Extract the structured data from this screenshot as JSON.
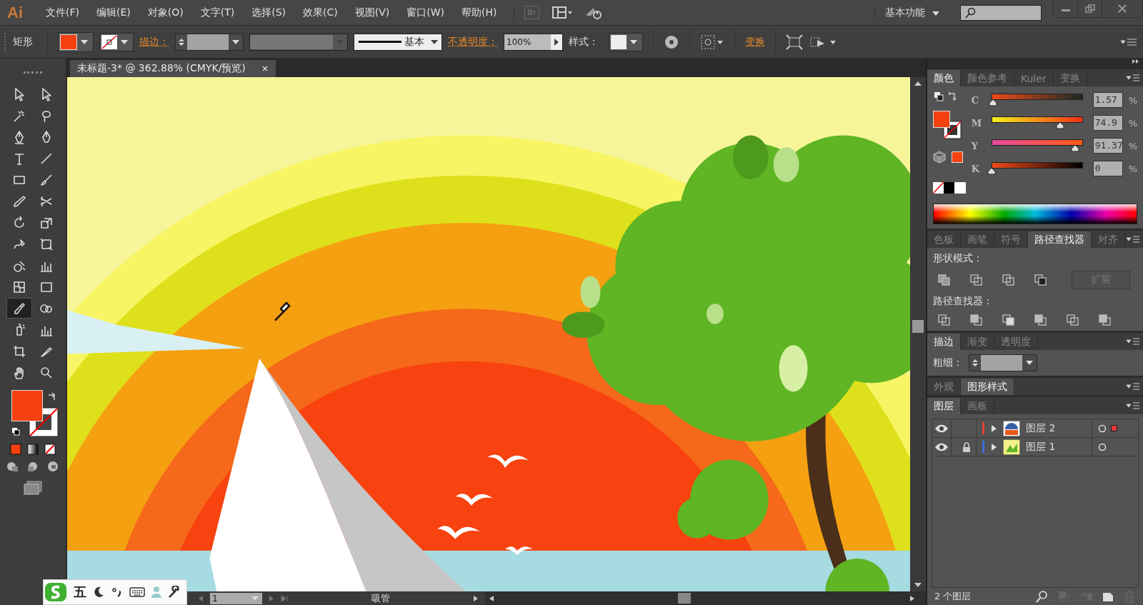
{
  "menu_bar": {
    "logo": "Ai",
    "items": [
      "文件(F)",
      "编辑(E)",
      "对象(O)",
      "文字(T)",
      "选择(S)",
      "效果(C)",
      "视图(V)",
      "窗口(W)",
      "帮助(H)"
    ],
    "bridge": "Br",
    "workspace": "基本功能"
  },
  "control_bar": {
    "object_type": "矩形",
    "stroke_label": "描边：",
    "stroke_style": "基本",
    "opacity_label": "不透明度：",
    "opacity": "100%",
    "style_label": "样式：",
    "transform_link": "变换"
  },
  "tools": [
    {
      "selected": false
    },
    {
      "selected": false
    },
    {
      "selected": false
    },
    {
      "selected": false
    },
    {
      "selected": false
    },
    {
      "selected": false
    },
    {
      "selected": false
    },
    {
      "selected": false
    },
    {
      "selected": false
    },
    {
      "selected": false
    },
    {
      "selected": false
    },
    {
      "selected": false
    },
    {
      "selected": false
    },
    {
      "selected": false
    },
    {
      "selected": false
    },
    {
      "selected": false
    },
    {
      "selected": false
    },
    {
      "selected": false
    },
    {
      "selected": false
    },
    {
      "selected": false
    },
    {
      "selected": true
    },
    {
      "selected": false
    },
    {
      "selected": false
    },
    {
      "selected": false
    },
    {
      "selected": false
    },
    {
      "selected": false
    },
    {
      "selected": false
    },
    {
      "selected": false
    }
  ],
  "document_tab": {
    "title": "未标题-3* @ 362.88% (CMYK/预览)"
  },
  "color_panel": {
    "tabs": [
      {
        "label": "颜色",
        "selected": true
      },
      {
        "label": "颜色参考",
        "selected": false
      },
      {
        "label": "Kuler",
        "selected": false
      },
      {
        "label": "变换",
        "selected": false
      }
    ],
    "channels": [
      {
        "name": "C",
        "value": "1.57",
        "unit": "%",
        "level": 0.0157
      },
      {
        "name": "M",
        "value": "74.9",
        "unit": "%",
        "level": 0.749
      },
      {
        "name": "Y",
        "value": "91.37",
        "unit": "%",
        "level": 0.9137
      },
      {
        "name": "K",
        "value": "0",
        "unit": "%",
        "level": 0
      }
    ]
  },
  "pathfinder_panel": {
    "tabs": [
      {
        "label": "色板",
        "selected": false
      },
      {
        "label": "画笔",
        "selected": false
      },
      {
        "label": "符号",
        "selected": false
      },
      {
        "label": "路径查找器",
        "selected": true
      },
      {
        "label": "对齐",
        "selected": false
      }
    ],
    "shape_modes_label": "形状模式：",
    "expand_button": "扩展",
    "pathfinders_label": "路径查找器："
  },
  "stroke_panel": {
    "tabs": [
      {
        "label": "描边",
        "selected": true
      },
      {
        "label": "渐变",
        "selected": false
      },
      {
        "label": "透明度",
        "selected": false
      }
    ],
    "weight_label": "粗细："
  },
  "appearance_panel": {
    "tabs": [
      {
        "label": "外观",
        "selected": false
      },
      {
        "label": "图形样式",
        "selected": true
      }
    ]
  },
  "layers_panel": {
    "tabs": [
      {
        "label": "图层",
        "selected": true
      },
      {
        "label": "画板",
        "selected": false
      }
    ],
    "layers": [
      {
        "name": "图层 2",
        "color": "#e8403a",
        "locked": false,
        "has_selection": true
      },
      {
        "name": "图层 1",
        "color": "#3f6fe0",
        "locked": true,
        "has_selection": false
      }
    ],
    "count": "2 个图层"
  },
  "status_bar": {
    "page": "1",
    "tool": "吸管"
  },
  "ime_bar": {
    "mode": "五"
  }
}
